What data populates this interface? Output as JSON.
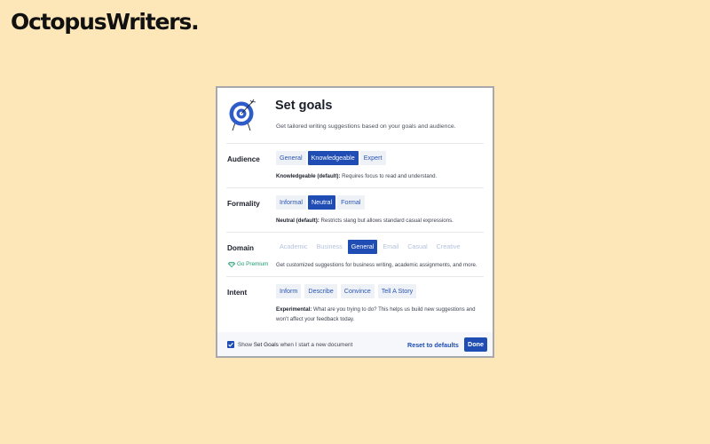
{
  "brand": {
    "name": "OctopusWriters."
  },
  "dialog": {
    "icon": "target-arrow-icon",
    "title": "Set goals",
    "subtitle": "Get tailored writing suggestions based on your goals and audience.",
    "sections": {
      "audience": {
        "label": "Audience",
        "options": [
          "General",
          "Knowledgeable",
          "Expert"
        ],
        "selected": "Knowledgeable",
        "desc_bold": "Knowledgeable (default):",
        "desc": "Requires focus to read and understand."
      },
      "formality": {
        "label": "Formality",
        "options": [
          "Informal",
          "Neutral",
          "Formal"
        ],
        "selected": "Neutral",
        "desc_bold": "Neutral (default):",
        "desc": "Restricts slang but allows standard casual expressions."
      },
      "domain": {
        "label": "Domain",
        "premium": "Go Premium",
        "options": [
          "Academic",
          "Business",
          "General",
          "Email",
          "Casual",
          "Creative"
        ],
        "selected": "General",
        "desc": "Get customized suggestions for business writing, academic assignments, and more."
      },
      "intent": {
        "label": "Intent",
        "options": [
          "Inform",
          "Describe",
          "Convince",
          "Tell A Story"
        ],
        "desc_bold": "Experimental:",
        "desc": "What are you trying to do? This helps us build new suggestions and won't affect your feedback today."
      }
    },
    "footer": {
      "show_checked": true,
      "show_prefix": "Show",
      "show_bold": "Set Goals",
      "show_suffix": "when I start a new document",
      "reset_label": "Reset to defaults",
      "done_label": "Done"
    }
  },
  "colors": {
    "background": "#fde6b8",
    "accent": "#1f4db4",
    "option_bg": "#eef1f6",
    "premium": "#1d9a6c"
  }
}
